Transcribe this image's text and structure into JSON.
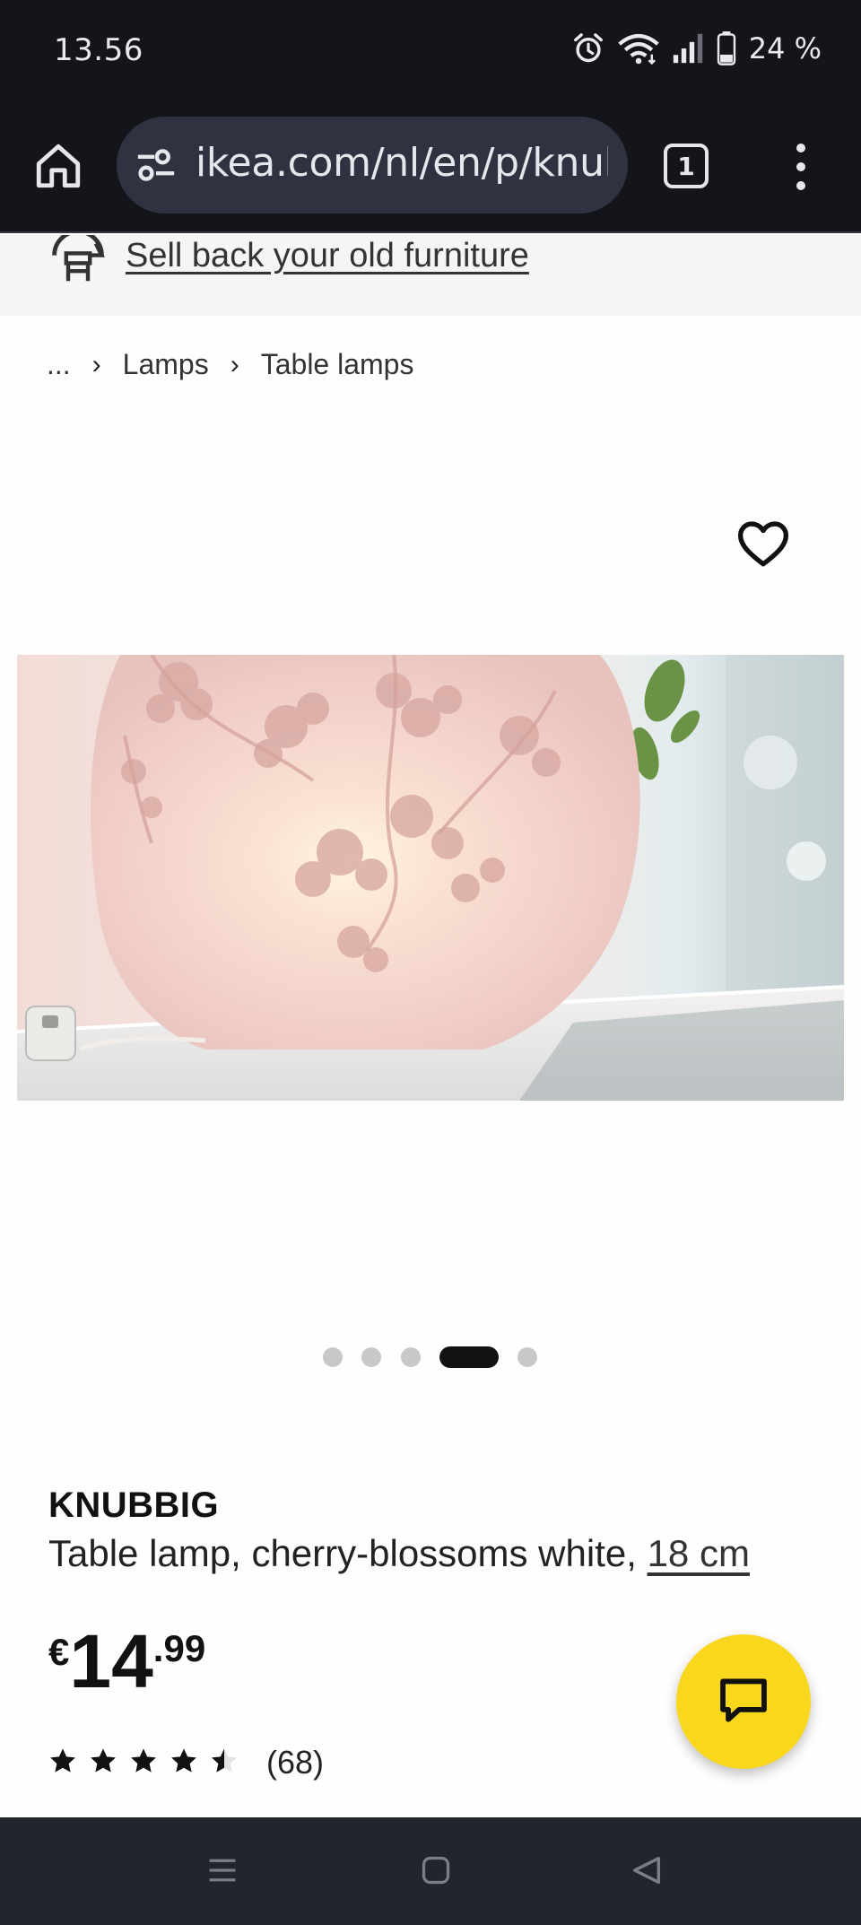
{
  "status_bar": {
    "time": "13.56",
    "battery": "24 %",
    "icons": [
      "alarm-icon",
      "wifi-icon",
      "signal-icon",
      "battery-icon"
    ]
  },
  "browser": {
    "url": "ikea.com/nl/en/p/knubbig-table-lamp",
    "tab_count": "1",
    "icons": [
      "home-icon",
      "site-settings-icon",
      "tabs-icon",
      "more-vert-icon"
    ]
  },
  "banner": {
    "sell_back_label": "Sell back your old furniture",
    "icon": "buyback-icon"
  },
  "breadcrumb": {
    "ellipsis": "...",
    "items": [
      "Lamps",
      "Table lamps"
    ]
  },
  "gallery": {
    "image_alt": "KNUBBIG table lamp with cherry blossom pattern, lit",
    "total_images": 5,
    "active_index": 3
  },
  "product": {
    "name": "KNUBBIG",
    "description": "Table lamp, cherry-blossoms white, ",
    "size_link": "18 cm",
    "price_currency": "€",
    "price_integer": "14",
    "price_decimal": ".99",
    "rating_stars": 4.5,
    "review_count": "(68)"
  },
  "colors": {
    "accent_yellow": "#f9d71c",
    "system_bar": "#14151b",
    "nav_bar": "#23252c"
  }
}
